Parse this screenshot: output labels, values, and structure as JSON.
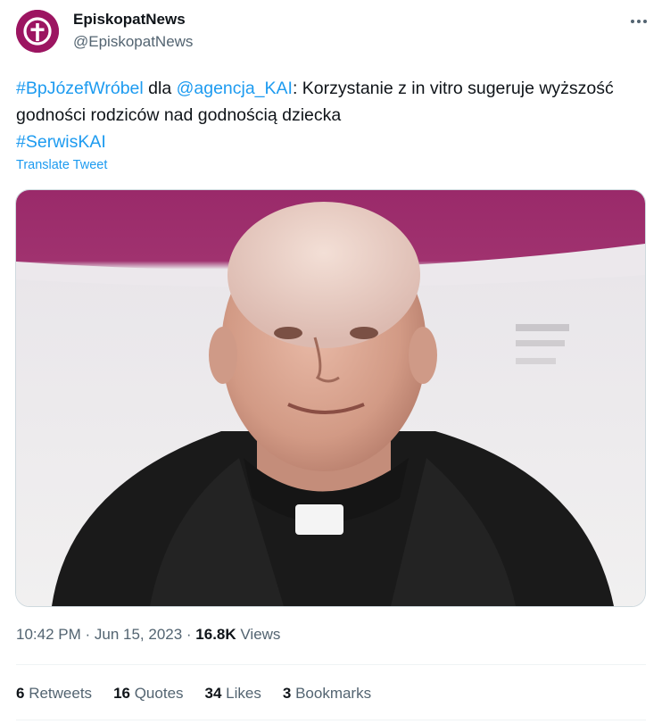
{
  "account": {
    "display_name": "EpiskopatNews",
    "handle": "@EpiskopatNews",
    "avatar_color": "#9c1561"
  },
  "tweet": {
    "hashtag1": "#BpJózefWróbel",
    "text_mid1": " dla ",
    "mention": "@agencja_KAI",
    "text_mid2": ": Korzystanie z in vitro sugeruje wyższość godności rodziców nad godnością dziecka",
    "hashtag2": "#SerwisKAI",
    "translate_label": "Translate Tweet",
    "link_color": "#1d9bf0"
  },
  "meta": {
    "time": "10:42 PM",
    "date": "Jun 15, 2023",
    "separator": " · ",
    "views_count": "16.8K",
    "views_label": " Views"
  },
  "stats": {
    "retweets_count": "6",
    "retweets_label": " Retweets",
    "quotes_count": "16",
    "quotes_label": " Quotes",
    "likes_count": "34",
    "likes_label": " Likes",
    "bookmarks_count": "3",
    "bookmarks_label": " Bookmarks"
  },
  "icons": {
    "avatar_logo": "cross-logo-icon",
    "more": "more-horizontal-icon"
  }
}
